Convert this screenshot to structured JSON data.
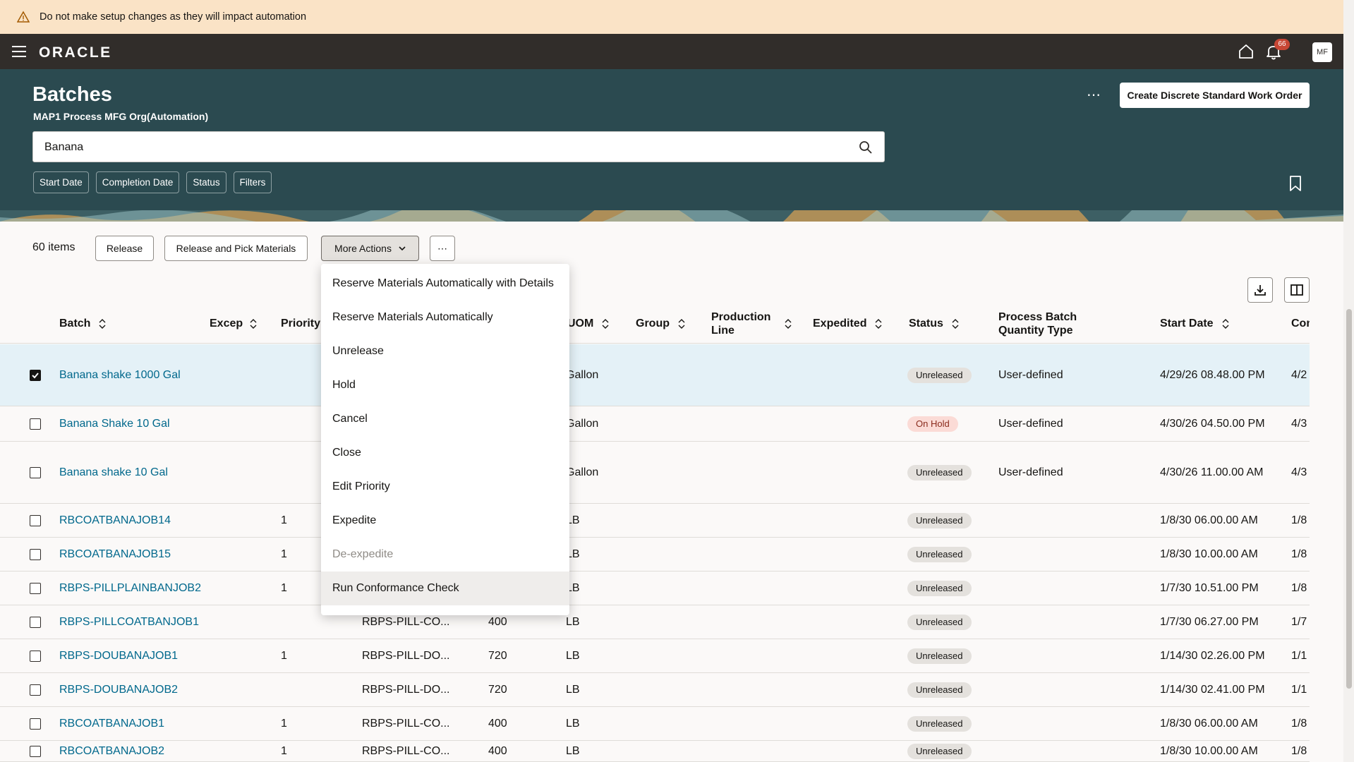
{
  "banner": {
    "text": "Do not make setup changes as they will impact automation",
    "icon": "warning-triangle-icon"
  },
  "topbar": {
    "brand": "ORACLE",
    "notifications_count": "66",
    "user_initials": "MF"
  },
  "header": {
    "title": "Batches",
    "subtitle": "MAP1 Process MFG Org(Automation)",
    "more_label": "⋯",
    "create_button": "Create Discrete Standard Work Order",
    "search_value": "Banana",
    "chips": [
      "Start Date",
      "Completion Date",
      "Status",
      "Filters"
    ]
  },
  "toolbar": {
    "items_count": "60 items",
    "release": "Release",
    "release_pick": "Release and Pick Materials",
    "more_actions": "More Actions",
    "overflow": "⋯"
  },
  "menu": {
    "items": [
      {
        "label": "Reserve Materials Automatically with Details",
        "disabled": false
      },
      {
        "label": "Reserve Materials Automatically",
        "disabled": false
      },
      {
        "label": "Unrelease",
        "disabled": false
      },
      {
        "label": "Hold",
        "disabled": false
      },
      {
        "label": "Cancel",
        "disabled": false
      },
      {
        "label": "Close",
        "disabled": false
      },
      {
        "label": "Edit Priority",
        "disabled": false
      },
      {
        "label": "Expedite",
        "disabled": false
      },
      {
        "label": "De-expedite",
        "disabled": true
      },
      {
        "label": "Run Conformance Check",
        "disabled": false,
        "hovered": true
      }
    ]
  },
  "table": {
    "columns": [
      "Batch",
      "Excep",
      "Priority",
      "UOM",
      "Group",
      "Production Line",
      "Expedited",
      "Status",
      "Process Batch Quantity Type",
      "Start Date",
      "Con"
    ],
    "rows": [
      {
        "batch": "Banana shake 1000 Gal",
        "priority": "",
        "item": "",
        "qty": "",
        "uom": "Gallon",
        "status": "Unreleased",
        "qtytype": "User-defined",
        "start": "4/29/26 08.48.00 PM",
        "comp": "4/2",
        "selected": true
      },
      {
        "batch": "Banana Shake 10 Gal",
        "priority": "",
        "item": "",
        "qty": "",
        "uom": "Gallon",
        "status": "On Hold",
        "qtytype": "User-defined",
        "start": "4/30/26 04.50.00 PM",
        "comp": "4/3",
        "selected": false
      },
      {
        "batch": "Banana shake 10 Gal",
        "priority": "",
        "item": "",
        "qty": "",
        "uom": "Gallon",
        "status": "Unreleased",
        "qtytype": "User-defined",
        "start": "4/30/26 11.00.00 AM",
        "comp": "4/3",
        "selected": false
      },
      {
        "batch": "RBCOATBANAJOB14",
        "priority": "1",
        "item": "",
        "qty": "",
        "uom": "LB",
        "status": "Unreleased",
        "qtytype": "",
        "start": "1/8/30 06.00.00 AM",
        "comp": "1/8",
        "selected": false
      },
      {
        "batch": "RBCOATBANAJOB15",
        "priority": "1",
        "item": "",
        "qty": "",
        "uom": "LB",
        "status": "Unreleased",
        "qtytype": "",
        "start": "1/8/30 10.00.00 AM",
        "comp": "1/8",
        "selected": false
      },
      {
        "batch": "RBPS-PILLPLAINBANJOB2",
        "priority": "1",
        "item": "",
        "qty": "",
        "uom": "LB",
        "status": "Unreleased",
        "qtytype": "",
        "start": "1/7/30 10.51.00 PM",
        "comp": "1/8",
        "selected": false
      },
      {
        "batch": "RBPS-PILLCOATBANJOB1",
        "priority": "",
        "item": "RBPS-PILL-CO...",
        "qty": "400",
        "uom": "LB",
        "status": "Unreleased",
        "qtytype": "",
        "start": "1/7/30 06.27.00 PM",
        "comp": "1/7",
        "selected": false
      },
      {
        "batch": "RBPS-DOUBANAJOB1",
        "priority": "1",
        "item": "RBPS-PILL-DO...",
        "qty": "720",
        "uom": "LB",
        "status": "Unreleased",
        "qtytype": "",
        "start": "1/14/30 02.26.00 PM",
        "comp": "1/1",
        "selected": false
      },
      {
        "batch": "RBPS-DOUBANAJOB2",
        "priority": "",
        "item": "RBPS-PILL-DO...",
        "qty": "720",
        "uom": "LB",
        "status": "Unreleased",
        "qtytype": "",
        "start": "1/14/30 02.41.00 PM",
        "comp": "1/1",
        "selected": false
      },
      {
        "batch": "RBCOATBANAJOB1",
        "priority": "1",
        "item": "RBPS-PILL-CO...",
        "qty": "400",
        "uom": "LB",
        "status": "Unreleased",
        "qtytype": "",
        "start": "1/8/30 06.00.00 AM",
        "comp": "1/8",
        "selected": false
      },
      {
        "batch": "RBCOATBANAJOB2",
        "priority": "1",
        "item": "RBPS-PILL-CO...",
        "qty": "400",
        "uom": "LB",
        "status": "Unreleased",
        "qtytype": "",
        "start": "1/8/30 10.00.00 AM",
        "comp": "1/8",
        "selected": false
      }
    ]
  },
  "colors": {
    "header_bg": "#2b4a50",
    "topbar_bg": "#312d2a",
    "banner_bg": "#fae3c6",
    "link": "#00688c",
    "selected_row": "#e4f1f7"
  }
}
